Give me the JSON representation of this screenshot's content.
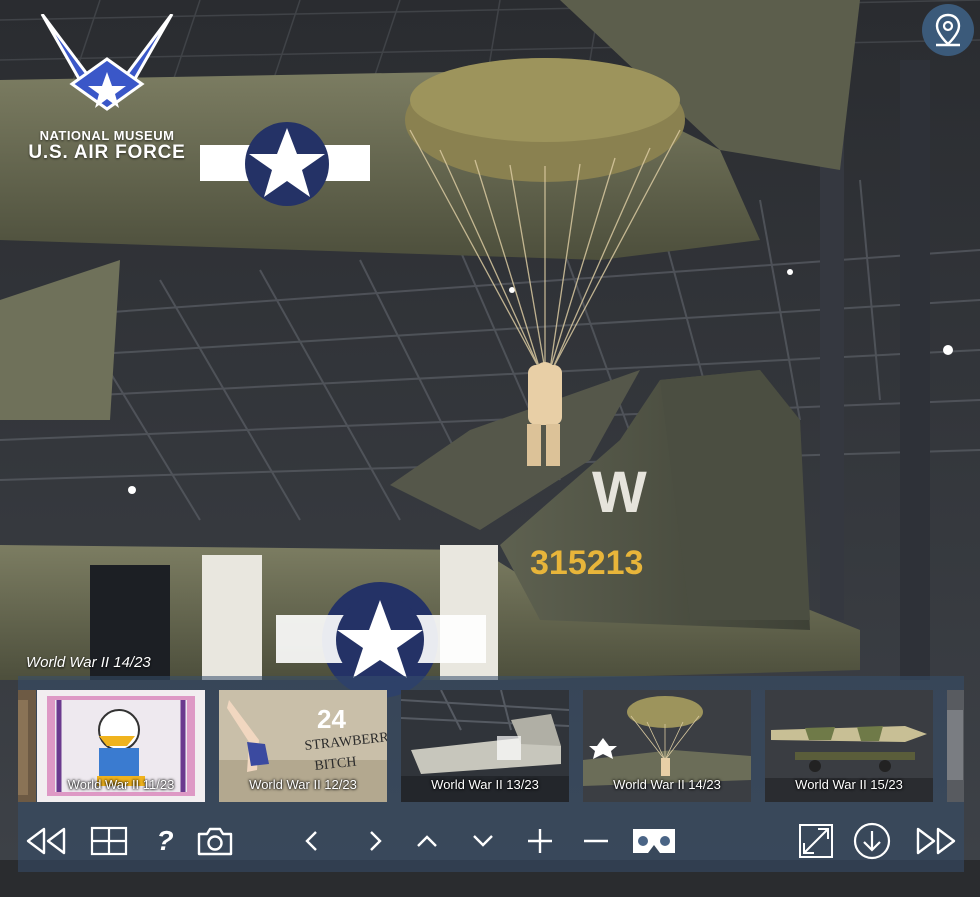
{
  "app": {
    "logo_line1": "NATIONAL MUSEUM",
    "logo_line2": "U.S. AIR FORCE"
  },
  "scene": {
    "tail_letter": "W",
    "tail_number": "315213"
  },
  "current_title": "World War II 14/23",
  "thumbnails": [
    {
      "label": "World War II 11/23",
      "theme": "art-poster",
      "active": false
    },
    {
      "label": "World War II 12/23",
      "theme": "nose-art",
      "active": false,
      "art_text1": "24",
      "art_text2": "STRAWBERRY",
      "art_text3": "BITCH"
    },
    {
      "label": "World War II 13/23",
      "theme": "aircraft-hangar",
      "active": false
    },
    {
      "label": "World War II 14/23",
      "theme": "parachute",
      "active": true
    },
    {
      "label": "World War II 15/23",
      "theme": "rocket",
      "active": false
    }
  ],
  "toolbar": {
    "help_label": "?",
    "buttons": [
      "rewind-icon",
      "thumbnails-grid-icon",
      "help-icon",
      "camera-icon",
      "chevron-left-icon",
      "chevron-right-icon",
      "chevron-up-icon",
      "chevron-down-icon",
      "zoom-in-icon",
      "zoom-out-icon",
      "vr-headset-icon",
      "fullscreen-icon",
      "download-icon",
      "fast-forward-icon"
    ]
  },
  "colors": {
    "panel": "#364e6c",
    "map_button": "#3b5a7a",
    "accent_white": "#ffffff"
  }
}
